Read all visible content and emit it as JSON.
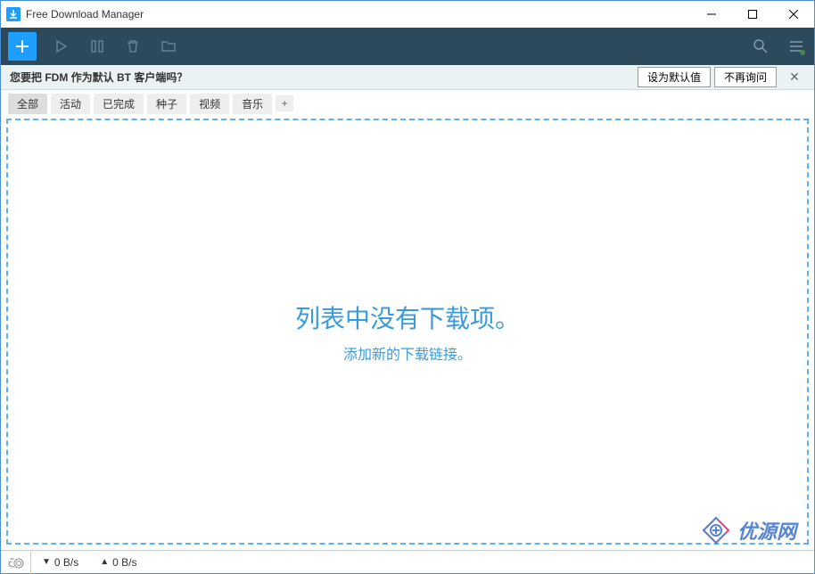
{
  "window": {
    "title": "Free Download Manager"
  },
  "toolbar": {
    "add": "+",
    "icons": [
      "play",
      "pause-all",
      "delete",
      "open-folder",
      "search",
      "menu"
    ]
  },
  "notice": {
    "text": "您要把 FDM 作为默认 BT 客户端吗？",
    "set_default": "设为默认值",
    "dont_ask": "不再询问"
  },
  "tabs": {
    "items": [
      "全部",
      "活动",
      "已完成",
      "种子",
      "视频",
      "音乐"
    ],
    "active_index": 0
  },
  "empty": {
    "title": "列表中没有下载项。",
    "subtitle": "添加新的下载链接。"
  },
  "status": {
    "download_speed": "0 B/s",
    "upload_speed": "0 B/s"
  },
  "watermark": {
    "text": "优源网"
  }
}
